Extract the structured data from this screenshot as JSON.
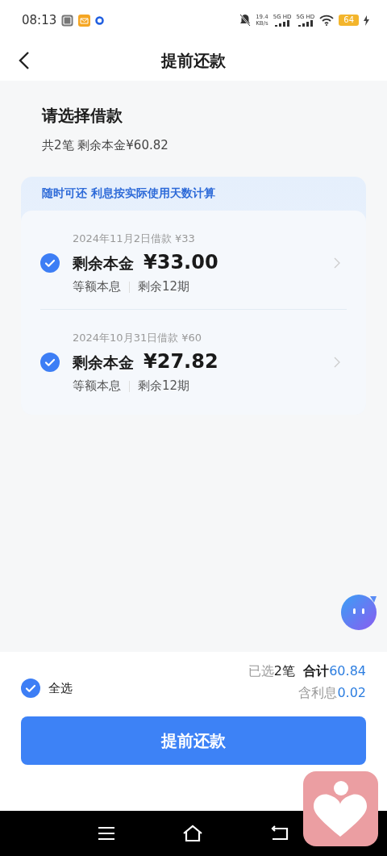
{
  "status_bar": {
    "time": "08:13",
    "speed": "19.4",
    "speed_unit": "KB/s",
    "networks": [
      "5G HD",
      "5G HD"
    ],
    "battery": "64"
  },
  "header": {
    "title": "提前还款"
  },
  "section": {
    "title": "请选择借款",
    "summary": "共2笔 剩余本金¥60.82"
  },
  "notice": "随时可还 利息按实际使用天数计算",
  "loans": [
    {
      "date": "2024年11月2日借款 ¥33",
      "label": "剩余本金",
      "amount": "¥33.00",
      "method": "等额本息",
      "remaining": "剩余12期",
      "selected": true
    },
    {
      "date": "2024年10月31日借款 ¥60",
      "label": "剩余本金",
      "amount": "¥27.82",
      "method": "等额本息",
      "remaining": "剩余12期",
      "selected": true
    }
  ],
  "footer": {
    "select_all": {
      "label": "全选",
      "checked": true
    },
    "selected_label": "已选",
    "selected_count": "2笔",
    "total_label": "合计",
    "total_value": "60.84",
    "interest_label": "含利息",
    "interest_value": "0.02",
    "button": "提前还款"
  }
}
